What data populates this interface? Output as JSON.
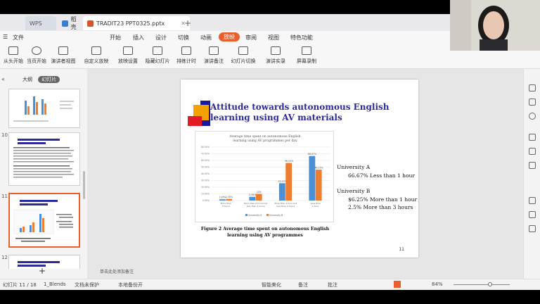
{
  "tabs": [
    {
      "label": "WPS"
    },
    {
      "label": "稻壳"
    },
    {
      "label": "TRADIT23 PPT0325.pptx"
    }
  ],
  "menu": {
    "file": "文件",
    "items": [
      "开始",
      "插入",
      "设计",
      "切换",
      "动画",
      "放映",
      "审阅",
      "视图",
      "特色功能"
    ],
    "active": "放映"
  },
  "ribbon": [
    {
      "label": "从头开始",
      "icon": "play-start-icon"
    },
    {
      "label": "当页开始",
      "icon": "play-current-icon"
    },
    {
      "label": "演讲者视图",
      "icon": "presenter-view-icon"
    },
    {
      "label": "自定义放映",
      "icon": "custom-show-icon"
    },
    {
      "label": "放映设置",
      "icon": "show-settings-icon"
    },
    {
      "label": "隐藏幻灯片",
      "icon": "hide-slide-icon"
    },
    {
      "label": "排练计时",
      "icon": "rehearse-timing-icon"
    },
    {
      "label": "演讲备注",
      "icon": "speaker-notes-icon"
    },
    {
      "label": "幻灯片切换",
      "icon": "slide-switch-icon"
    },
    {
      "label": "演讲实录",
      "icon": "record-icon"
    },
    {
      "label": "屏幕录制",
      "icon": "screen-record-icon"
    }
  ],
  "left_panel": {
    "outline_tab": "大纲",
    "slides_tab": "幻灯片",
    "numbers": [
      "10",
      "11",
      "12"
    ]
  },
  "slide": {
    "title": "Attitude towards autonomous English learning using AV materials",
    "caption": "Figure 2 Average time spent on autonomous English learning using AV programmes",
    "page_number": "11",
    "univ_a": "University A",
    "univ_a_line": "66.67% Less than 1 hour",
    "univ_b": "University B",
    "univ_b_line1": "$6.25% More than 1 hour",
    "univ_b_line2": "2.5%   More than 3 hours"
  },
  "notes_placeholder": "单击此处添加备注",
  "status": {
    "slide_info": "幻灯片 11 / 18",
    "theme": "1_Blends",
    "protect": "文档未保护",
    "backup": "本地备份开",
    "beautify": "智能美化",
    "notes": "备注",
    "comments": "批注",
    "zoom": "84%"
  },
  "chart_data": {
    "type": "bar",
    "title": "Average time spent on autonomous English learning using AV programmes per day",
    "categories": [
      "More than 3 hours",
      "More than 2 hours but less than 3 hours",
      "More than 1 hour but less than 2 hours",
      "Less than 1 hour"
    ],
    "series": [
      {
        "name": "University A",
        "values": [
          1.85,
          5.56,
          25.93,
          66.67
        ],
        "color": "#4a90d9"
      },
      {
        "name": "University B",
        "values": [
          2.5,
          10,
          56.25,
          46.25
        ],
        "color": "#ed7d31"
      }
    ],
    "ylim": [
      0,
      80
    ],
    "yticks": [
      "0.00%",
      "10.00%",
      "20.00%",
      "30.00%",
      "40.00%",
      "50.00%",
      "60.00%",
      "70.00%",
      "80.00%"
    ],
    "data_labels_a": [
      "1.85%",
      "5.56%",
      "25.93%",
      "66.67%"
    ],
    "data_labels_b": [
      "2.50%",
      "10%",
      "56.25%",
      "46.25%"
    ]
  }
}
